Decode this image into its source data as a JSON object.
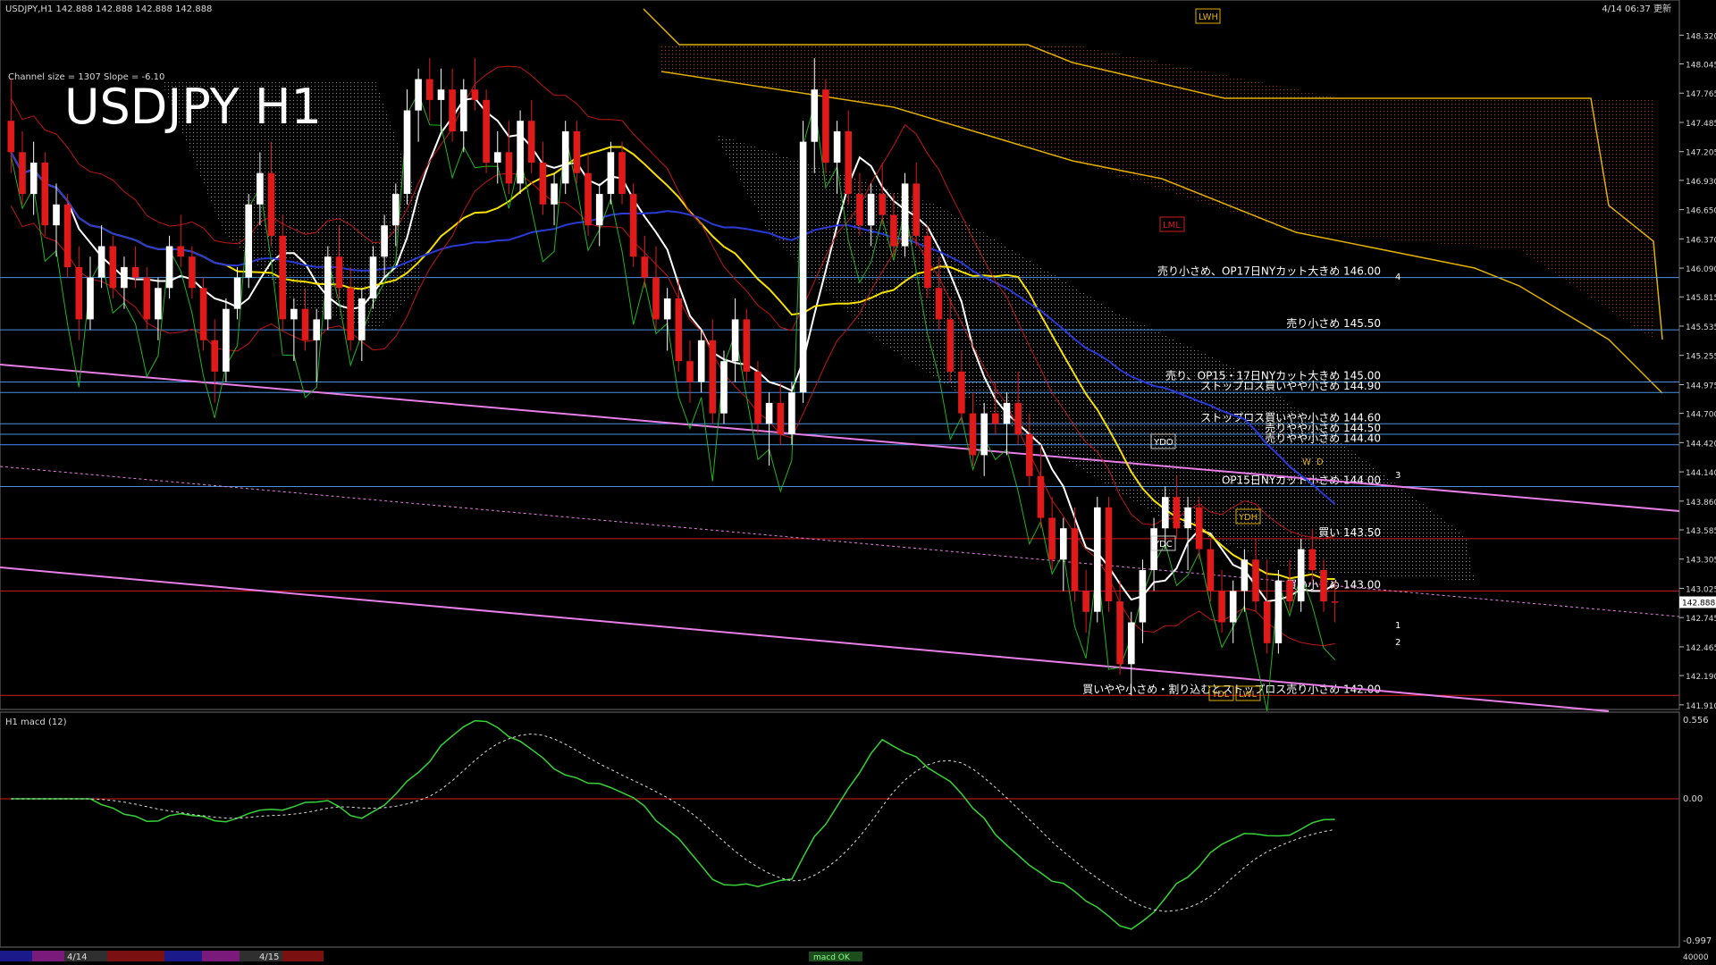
{
  "header": {
    "info": "USDJPY,H1  142.888 142.888 142.888 142.888",
    "timestamp": "4/14 06:37 更新",
    "channel": "Channel size = 1307 Slope = -6.10",
    "title": "USDJPY H1"
  },
  "macd_panel": {
    "label": "H1  macd (12)",
    "scale_top": "0.556",
    "scale_zero": "0.00",
    "scale_bottom": "-0.997",
    "footer_value": "40000",
    "footer_tag": "macd OK"
  },
  "chart_data": {
    "type": "candlestick",
    "symbol": "USDJPY",
    "timeframe": "H1",
    "ylim": [
      141.9,
      148.4
    ],
    "y_ticks": [
      "148.320",
      "148.045",
      "147.765",
      "147.485",
      "147.205",
      "146.930",
      "146.650",
      "146.370",
      "146.090",
      "145.815",
      "145.535",
      "145.255",
      "144.975",
      "144.700",
      "144.420",
      "144.140",
      "143.860",
      "143.585",
      "143.305",
      "143.025",
      "142.745",
      "142.465",
      "142.190",
      "141.910"
    ],
    "current_price": "142.888",
    "x_labels": [
      "4/14",
      "4/15"
    ],
    "levels": [
      {
        "price": 146.0,
        "label": "売り小さめ、OP17日NYカット大きめ 146.00",
        "color": "#4a90e2"
      },
      {
        "price": 145.5,
        "label": "売り小さめ 145.50",
        "color": "#4a90e2"
      },
      {
        "price": 145.0,
        "label": "売り、OP15・17日NYカット大きめ 145.00",
        "color": "#4a90e2"
      },
      {
        "price": 144.9,
        "label": "ストップロス買いやや小さめ 144.90",
        "color": "#4a90e2"
      },
      {
        "price": 144.6,
        "label": "ストップロス買いやや小さめ 144.60",
        "color": "#4a90e2"
      },
      {
        "price": 144.5,
        "label": "売りやや小さめ 144.50",
        "color": "#4a90e2"
      },
      {
        "price": 144.4,
        "label": "売りやや小さめ 144.40",
        "color": "#4a90e2"
      },
      {
        "price": 144.0,
        "label": "OP15日NYカット小さめ 144.00",
        "color": "#4a90e2"
      },
      {
        "price": 143.5,
        "label": "買い 143.50",
        "color": "#d21e1e"
      },
      {
        "price": 143.0,
        "label": "買い小さめ 143.00",
        "color": "#d21e1e"
      },
      {
        "price": 142.0,
        "label": "買いやや小さめ・割り込むとストップロス売り小さめ 142.00",
        "color": "#d21e1e"
      }
    ],
    "markers": [
      "LWH",
      "LML",
      "YDO",
      "YDC",
      "YDH",
      "YDL",
      "LWL",
      "W",
      "D",
      "1",
      "2",
      "3",
      "4"
    ],
    "candles": [
      [
        147.5,
        147.9,
        147.0,
        147.2
      ],
      [
        147.2,
        147.4,
        146.7,
        146.8
      ],
      [
        146.8,
        147.3,
        146.6,
        147.1
      ],
      [
        147.1,
        147.2,
        146.4,
        146.5
      ],
      [
        146.5,
        146.9,
        146.2,
        146.7
      ],
      [
        146.7,
        146.8,
        146.0,
        146.1
      ],
      [
        146.1,
        146.3,
        145.4,
        145.6
      ],
      [
        145.6,
        146.2,
        145.5,
        146.0
      ],
      [
        146.0,
        146.5,
        145.9,
        146.3
      ],
      [
        146.3,
        146.4,
        145.8,
        145.9
      ],
      [
        145.9,
        146.2,
        145.7,
        146.1
      ],
      [
        146.1,
        146.3,
        145.9,
        146.0
      ],
      [
        146.0,
        146.1,
        145.5,
        145.6
      ],
      [
        145.6,
        146.0,
        145.4,
        145.9
      ],
      [
        145.9,
        146.4,
        145.8,
        146.3
      ],
      [
        146.3,
        146.6,
        146.1,
        146.2
      ],
      [
        146.2,
        146.3,
        145.8,
        145.9
      ],
      [
        145.9,
        146.0,
        145.3,
        145.4
      ],
      [
        145.4,
        145.6,
        144.8,
        145.1
      ],
      [
        145.1,
        145.8,
        145.0,
        145.7
      ],
      [
        145.7,
        146.1,
        145.6,
        146.0
      ],
      [
        146.0,
        146.8,
        145.9,
        146.7
      ],
      [
        146.7,
        147.2,
        146.5,
        147.0
      ],
      [
        147.0,
        147.3,
        146.3,
        146.4
      ],
      [
        146.4,
        146.6,
        145.5,
        145.6
      ],
      [
        145.6,
        145.8,
        145.2,
        145.7
      ],
      [
        145.7,
        145.9,
        145.3,
        145.4
      ],
      [
        145.4,
        145.7,
        145.0,
        145.6
      ],
      [
        145.6,
        146.3,
        145.5,
        146.2
      ],
      [
        146.2,
        146.5,
        145.8,
        145.9
      ],
      [
        145.9,
        146.1,
        145.3,
        145.4
      ],
      [
        145.4,
        145.9,
        145.2,
        145.8
      ],
      [
        145.8,
        146.3,
        145.7,
        146.2
      ],
      [
        146.2,
        146.6,
        146.0,
        146.5
      ],
      [
        146.5,
        146.9,
        146.3,
        146.8
      ],
      [
        146.8,
        147.8,
        146.7,
        147.6
      ],
      [
        147.6,
        148.0,
        147.3,
        147.9
      ],
      [
        147.9,
        148.1,
        147.5,
        147.7
      ],
      [
        147.7,
        148.0,
        147.4,
        147.8
      ],
      [
        147.8,
        148.0,
        147.3,
        147.4
      ],
      [
        147.4,
        147.9,
        147.2,
        147.8
      ],
      [
        147.8,
        148.1,
        147.6,
        147.7
      ],
      [
        147.7,
        147.8,
        147.0,
        147.1
      ],
      [
        147.1,
        147.4,
        146.9,
        147.2
      ],
      [
        147.2,
        147.5,
        146.8,
        146.9
      ],
      [
        146.9,
        147.6,
        146.8,
        147.5
      ],
      [
        147.5,
        147.7,
        147.0,
        147.1
      ],
      [
        147.1,
        147.3,
        146.6,
        146.7
      ],
      [
        146.7,
        147.0,
        146.5,
        146.9
      ],
      [
        146.9,
        147.5,
        146.8,
        147.4
      ],
      [
        147.4,
        147.5,
        146.9,
        147.0
      ],
      [
        147.0,
        147.2,
        146.4,
        146.5
      ],
      [
        146.5,
        146.9,
        146.3,
        146.8
      ],
      [
        146.8,
        147.3,
        146.7,
        147.2
      ],
      [
        147.2,
        147.3,
        146.7,
        146.8
      ],
      [
        146.8,
        146.9,
        146.1,
        146.2
      ],
      [
        146.2,
        146.4,
        145.9,
        146.0
      ],
      [
        146.0,
        146.3,
        145.5,
        145.6
      ],
      [
        145.6,
        145.9,
        145.3,
        145.8
      ],
      [
        145.8,
        146.0,
        145.1,
        145.2
      ],
      [
        145.2,
        145.4,
        144.8,
        145.0
      ],
      [
        145.0,
        145.5,
        144.9,
        145.4
      ],
      [
        145.4,
        145.6,
        144.6,
        144.7
      ],
      [
        144.7,
        145.3,
        144.6,
        145.2
      ],
      [
        145.2,
        145.8,
        145.0,
        145.6
      ],
      [
        145.6,
        145.7,
        145.0,
        145.1
      ],
      [
        145.1,
        145.2,
        144.5,
        144.6
      ],
      [
        144.6,
        144.9,
        144.2,
        144.8
      ],
      [
        144.8,
        145.0,
        144.4,
        144.5
      ],
      [
        144.5,
        145.0,
        144.4,
        144.9
      ],
      [
        144.9,
        147.5,
        144.8,
        147.3
      ],
      [
        147.3,
        148.1,
        147.0,
        147.8
      ],
      [
        147.8,
        147.9,
        147.0,
        147.1
      ],
      [
        147.1,
        147.5,
        146.8,
        147.4
      ],
      [
        147.4,
        147.6,
        146.7,
        146.8
      ],
      [
        146.8,
        147.0,
        146.4,
        146.5
      ],
      [
        146.5,
        146.9,
        146.3,
        146.8
      ],
      [
        146.8,
        147.1,
        146.5,
        146.6
      ],
      [
        146.6,
        146.8,
        146.2,
        146.3
      ],
      [
        146.3,
        147.0,
        146.2,
        146.9
      ],
      [
        146.9,
        147.1,
        146.3,
        146.4
      ],
      [
        146.4,
        146.5,
        145.8,
        145.9
      ],
      [
        145.9,
        146.2,
        145.5,
        145.6
      ],
      [
        145.6,
        145.8,
        145.0,
        145.1
      ],
      [
        145.1,
        145.3,
        144.6,
        144.7
      ],
      [
        144.7,
        144.9,
        144.2,
        144.3
      ],
      [
        144.3,
        144.8,
        144.1,
        144.7
      ],
      [
        144.7,
        145.0,
        144.5,
        144.6
      ],
      [
        144.6,
        144.9,
        144.3,
        144.8
      ],
      [
        144.8,
        145.1,
        144.4,
        144.5
      ],
      [
        144.5,
        144.7,
        144.0,
        144.1
      ],
      [
        144.1,
        144.4,
        143.6,
        143.7
      ],
      [
        143.7,
        143.9,
        143.2,
        143.3
      ],
      [
        143.3,
        143.7,
        143.0,
        143.6
      ],
      [
        143.6,
        143.8,
        142.9,
        143.0
      ],
      [
        143.0,
        143.2,
        142.6,
        142.8
      ],
      [
        142.8,
        143.9,
        142.7,
        143.8
      ],
      [
        143.8,
        143.9,
        142.8,
        142.9
      ],
      [
        142.9,
        143.1,
        142.2,
        142.3
      ],
      [
        142.3,
        142.8,
        142.0,
        142.7
      ],
      [
        142.7,
        143.3,
        142.5,
        143.2
      ],
      [
        143.2,
        143.7,
        143.0,
        143.6
      ],
      [
        143.6,
        144.0,
        143.4,
        143.9
      ],
      [
        143.9,
        144.1,
        143.5,
        143.6
      ],
      [
        143.6,
        143.9,
        143.2,
        143.8
      ],
      [
        143.8,
        143.9,
        143.3,
        143.4
      ],
      [
        143.4,
        143.5,
        142.9,
        143.0
      ],
      [
        143.0,
        143.2,
        142.6,
        142.7
      ],
      [
        142.7,
        143.1,
        142.5,
        143.0
      ],
      [
        143.0,
        143.4,
        142.8,
        143.3
      ],
      [
        143.3,
        143.5,
        142.8,
        142.9
      ],
      [
        142.9,
        143.3,
        142.4,
        142.5
      ],
      [
        142.5,
        143.2,
        142.4,
        143.1
      ],
      [
        143.1,
        143.3,
        142.8,
        142.9
      ],
      [
        142.9,
        143.5,
        142.8,
        143.4
      ],
      [
        143.4,
        143.6,
        143.1,
        143.2
      ],
      [
        143.2,
        143.3,
        142.8,
        142.9
      ],
      [
        142.9,
        143.1,
        142.7,
        142.888
      ]
    ]
  }
}
